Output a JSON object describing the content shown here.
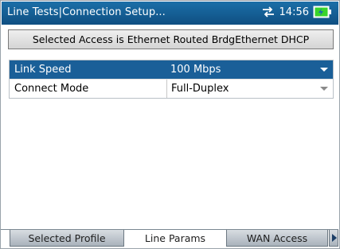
{
  "window": {
    "title": "Line Tests|Connection Setup...",
    "clock": "14:56"
  },
  "banner": {
    "text": "Selected Access  is Ethernet Routed BrdgEthernet DHCP"
  },
  "params": [
    {
      "label": "Link Speed",
      "value": "100 Mbps",
      "selected": true
    },
    {
      "label": "Connect Mode",
      "value": "Full-Duplex",
      "selected": false
    }
  ],
  "tabs": [
    {
      "label": "Selected Profile",
      "active": false
    },
    {
      "label": "Line Params",
      "active": true
    },
    {
      "label": "WAN Access",
      "active": false
    }
  ],
  "icons": {
    "network": "network-transfer-icon",
    "battery": "battery-charging-icon",
    "scroll": "tab-scroll-right-icon"
  },
  "colors": {
    "titlebar": "#1b6fa8",
    "selection": "#1a5f98",
    "battery": "#39d42a"
  }
}
